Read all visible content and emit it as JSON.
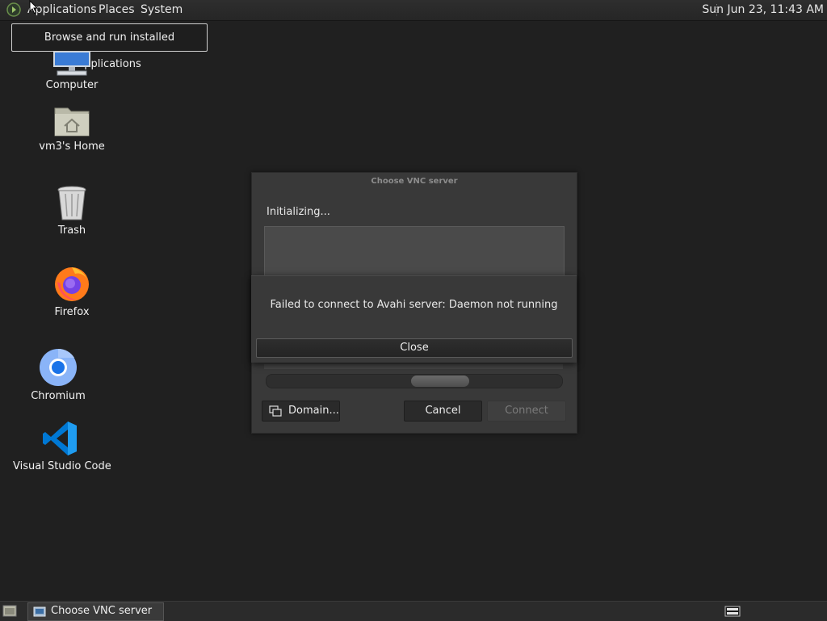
{
  "top_panel": {
    "menus": [
      "Applications",
      "Places",
      "System"
    ],
    "clock": "Sun Jun 23, 11:43 AM"
  },
  "tooltip": "Browse and run installed applications",
  "desktop_icons": [
    {
      "label": "Computer",
      "icon": "computer-icon"
    },
    {
      "label": "vm3's Home",
      "icon": "home-folder-icon"
    },
    {
      "label": "Trash",
      "icon": "trash-icon"
    },
    {
      "label": "Firefox",
      "icon": "firefox-icon"
    },
    {
      "label": "Chromium",
      "icon": "chromium-icon"
    },
    {
      "label": "Visual Studio Code",
      "icon": "vscode-icon"
    }
  ],
  "vnc_dialog": {
    "title": "Choose VNC server",
    "status": "Initializing...",
    "buttons": {
      "domain": "Domain...",
      "cancel": "Cancel",
      "connect": "Connect"
    }
  },
  "error_dialog": {
    "message": "Failed to connect to Avahi server: Daemon not running",
    "close_label": "Close"
  },
  "taskbar": {
    "window_title": "Choose VNC server"
  },
  "colors": {
    "desktop_bg": "#202020",
    "panel_bg": "#2b2b2b",
    "dialog_bg": "#393939"
  }
}
